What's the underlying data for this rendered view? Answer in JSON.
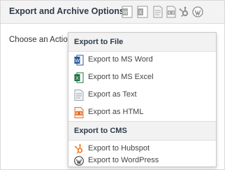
{
  "header": {
    "title": "Export and Archive Options",
    "icons": [
      "word-icon",
      "excel-icon",
      "text-icon",
      "html-icon",
      "hubspot-icon",
      "wordpress-icon"
    ]
  },
  "action": {
    "label": "Choose an Action"
  },
  "menu": {
    "groups": [
      {
        "label": "Export to File",
        "items": [
          {
            "label": "Export to MS Word",
            "icon": "word-icon",
            "color": "#2b579a"
          },
          {
            "label": "Export to MS Excel",
            "icon": "excel-icon",
            "color": "#217346"
          },
          {
            "label": "Export as Text",
            "icon": "text-icon",
            "color": "#9aa3ad"
          },
          {
            "label": "Export as HTML",
            "icon": "html-icon",
            "color": "#e4712c"
          }
        ]
      },
      {
        "label": "Export to CMS",
        "items": [
          {
            "label": "Export to Hubspot",
            "icon": "hubspot-icon",
            "color": "#f57722"
          },
          {
            "label": "Export to WordPress",
            "icon": "wordpress-icon",
            "color": "#464646"
          }
        ]
      }
    ]
  }
}
